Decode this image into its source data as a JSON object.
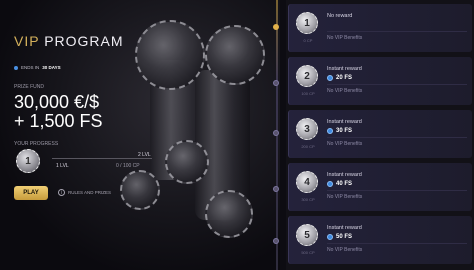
{
  "brand": {
    "vip": "VIP",
    "program": "PROGRAM"
  },
  "timer": {
    "prefix": "ENDS IN",
    "value": "30 DAYS"
  },
  "prize": {
    "label": "PRIZE FUND",
    "line1": "30,000 €/$",
    "line2": "+ 1,500 FS"
  },
  "progress": {
    "label": "YOUR PROGRESS",
    "current_level_badge": "1",
    "current_level": "1 LVL",
    "next_level": "2 LVL",
    "points": "0 / 100 CP",
    "percent": 0
  },
  "actions": {
    "play": "PLAY",
    "rules": "RULES AND PRIZES"
  },
  "rewards": [
    {
      "level": "1",
      "cp": "0 CP",
      "title": "No reward",
      "fs": "",
      "benefits": "No VIP Benefits"
    },
    {
      "level": "2",
      "cp": "100 CP",
      "title": "Instant reward",
      "fs": "20 FS",
      "benefits": "No VIP Benefits"
    },
    {
      "level": "3",
      "cp": "200 CP",
      "title": "Instant reward",
      "fs": "30 FS",
      "benefits": "No VIP Benefits"
    },
    {
      "level": "4",
      "cp": "300 CP",
      "title": "Instant reward",
      "fs": "40 FS",
      "benefits": "No VIP Benefits"
    },
    {
      "level": "5",
      "cp": "500 CP",
      "title": "Instant reward",
      "fs": "50 FS",
      "benefits": "No VIP Benefits"
    }
  ],
  "icons": {
    "timer": "blue-dot-icon",
    "rules": "info-icon",
    "fs": "free-spin-coin-icon"
  },
  "colors": {
    "accent_gold": "#e2b14a",
    "card_bg": "#24223b",
    "fs_blue": "#3f8be0"
  }
}
